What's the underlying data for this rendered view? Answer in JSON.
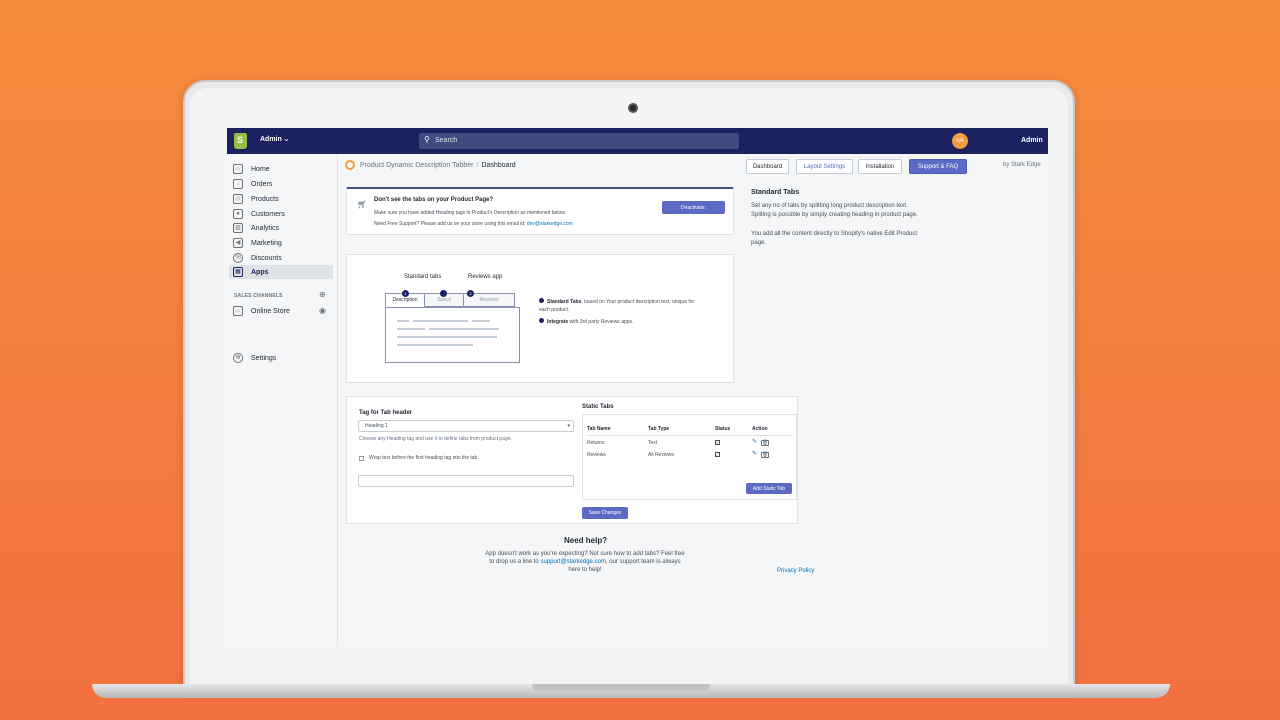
{
  "topbar": {
    "store_name": "Admin",
    "search_placeholder": "Search",
    "avatar_initials": "nA",
    "user_name": "Admin"
  },
  "sidebar": {
    "items": [
      {
        "label": "Home",
        "icon": "home-icon"
      },
      {
        "label": "Orders",
        "icon": "orders-icon"
      },
      {
        "label": "Products",
        "icon": "tag-icon"
      },
      {
        "label": "Customers",
        "icon": "person-icon"
      },
      {
        "label": "Analytics",
        "icon": "chart-icon"
      },
      {
        "label": "Marketing",
        "icon": "megaphone-icon"
      },
      {
        "label": "Discounts",
        "icon": "discount-icon"
      },
      {
        "label": "Apps",
        "icon": "apps-icon"
      }
    ],
    "sales_channels_label": "SALES CHANNELS",
    "online_store_label": "Online Store",
    "settings_label": "Settings"
  },
  "header": {
    "breadcrumb_app": "Product Dynamic Description Tabber",
    "breadcrumb_sep": "/",
    "breadcrumb_page": "Dashboard",
    "buttons": {
      "dashboard": "Dashboard",
      "layout_settings": "Layout Settings",
      "installation": "Installation",
      "support_faq": "Support & FAQ"
    },
    "by_text": "by Stark Edge"
  },
  "notice": {
    "title": "Don't see the tabs on your Product Page?",
    "line1": "Make sure you have added Heading tags in Product's Description as mentioned below.",
    "line2": "Need Free Support? Please add us on your store using this email id:",
    "email": "dev@starkedge.com",
    "deactivate_label": "Deactivate."
  },
  "side_info": {
    "title": "Standard Tabs",
    "p1": "Set any no of tabs by splitting long product description text. Spliting is possible by simply creating heading in product page.",
    "p2": "You add all the content directly to Shopify's native Edit Product page."
  },
  "diagram": {
    "label_standard": "Standard tabs",
    "label_reviews": "Reviews app",
    "tab_description": "Description",
    "tab_specs": "Specs",
    "tab_reviews": "Reviews",
    "num1": "1",
    "num2": "2",
    "bullet1_bold": "Standard Tabs",
    "bullet1_rest": ", based on Your product description text, unique for each product.",
    "bullet2_bold": "Integrate",
    "bullet2_rest": " with 3rd party Reviews apps."
  },
  "settings": {
    "tag_label": "Tag for Tab header",
    "tag_value": "Heading 1",
    "tag_help": "Choose any Heading tag and use it to define tabs from product page.",
    "wrap_label": "Wrap text before the first heading tag into the tab",
    "static_title": "Static Tabs",
    "columns": [
      "Tab Name",
      "Tab Type",
      "Status",
      "Action"
    ],
    "rows": [
      {
        "name": "Returns",
        "type": "Text"
      },
      {
        "name": "Reviews",
        "type": "Ali Reviews"
      }
    ],
    "add_static_label": "Add Static Tab",
    "save_label": "Save Changes"
  },
  "footer": {
    "need_help_title": "Need help?",
    "help_text_a": "App doesn't work as you're expecting? Not sure how to add tabs? Feel free to drop us a line to ",
    "help_email": "support@starkedge.com",
    "help_text_b": ", our support team is always here to help!",
    "privacy_label": "Privacy Policy"
  },
  "colors": {
    "topbar": "#1c2260",
    "primary": "#5c6ac4",
    "background": "#f3703f"
  }
}
